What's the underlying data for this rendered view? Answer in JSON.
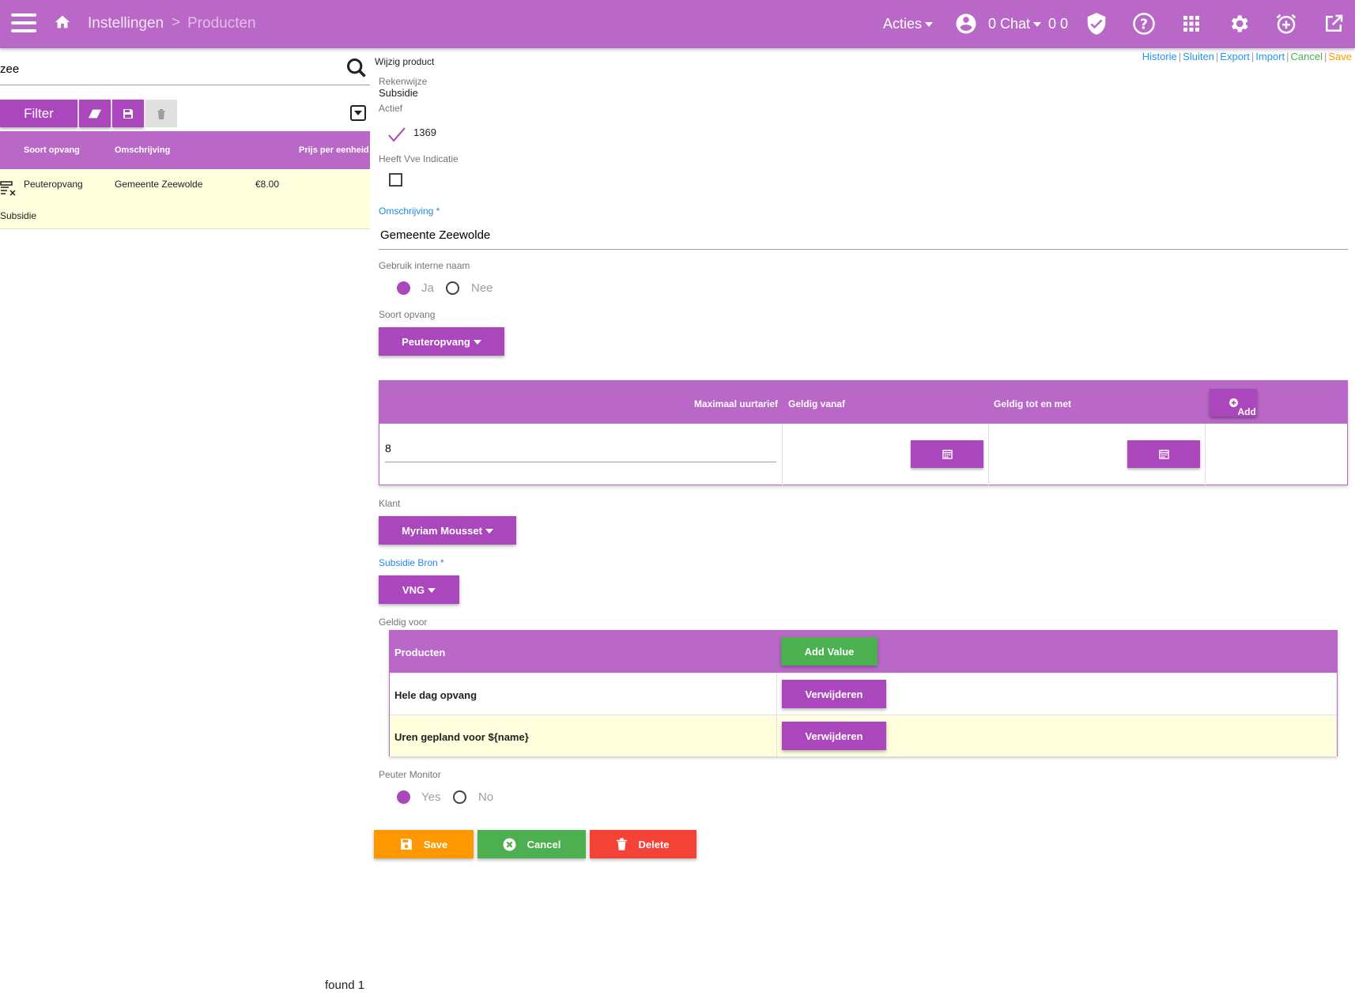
{
  "header": {
    "breadcrumb_1": "Instellingen",
    "breadcrumb_sep": ">",
    "breadcrumb_2": "Producten",
    "acties_label": "Acties",
    "chat_label": "0 Chat",
    "counts": "0 0",
    "bar_color": "#ba68c8"
  },
  "sidebar": {
    "search_value": "zee",
    "filter_label": "Filter",
    "columns": [
      "Soort opvang",
      "Omschrijving",
      "Prijs per eenheid"
    ],
    "rows": [
      {
        "soort": "Peuteropvang",
        "omschrijving": "Gemeente Zeewolde",
        "prijs": "€8.00",
        "sub": "Subsidie"
      }
    ],
    "found_text": "found 1"
  },
  "form": {
    "title": "Wijzig product",
    "links": {
      "historie": "Historie",
      "sluiten": "Sluiten",
      "export": "Export",
      "import": "Import",
      "cancel": "Cancel",
      "save": "Save"
    },
    "rekenwijze_label": "Rekenwijze",
    "rekenwijze_value": "Subsidie",
    "actief_label": "Actief",
    "actief_value": "1369",
    "vve_label": "Heeft Vve Indicatie",
    "omschrijving_label": "Omschrijving *",
    "omschrijving_value": "Gemeente Zeewolde",
    "interne_naam_label": "Gebruik interne naam",
    "interne_naam_yes": "Ja",
    "interne_naam_no": "Nee",
    "soort_opvang_label": "Soort opvang",
    "soort_opvang_value": "Peuteropvang",
    "rates_table": {
      "col_max": "Maximaal uurtarief",
      "col_from": "Geldig vanaf",
      "col_to": "Geldig tot en met",
      "add_label": "Add",
      "row_value": "8"
    },
    "klant_label": "Klant",
    "klant_value": "Myriam Mousset",
    "bron_label": "Subsidie Bron *",
    "bron_value": "VNG",
    "geldig_voor_label": "Geldig voor",
    "products_table": {
      "header": "Producten",
      "add_value_label": "Add Value",
      "remove_label": "Verwijderen",
      "rows": [
        "Hele dag opvang",
        "Uren gepland voor ${name}"
      ]
    },
    "monitor_label": "Peuter Monitor",
    "monitor_yes": "Yes",
    "monitor_no": "No",
    "save_label": "Save",
    "cancel_label": "Cancel",
    "delete_label": "Delete",
    "colors": {
      "save": "#ff9800",
      "cancel": "#4caf50",
      "delete": "#f44336",
      "accent": "#ab47bc"
    }
  }
}
